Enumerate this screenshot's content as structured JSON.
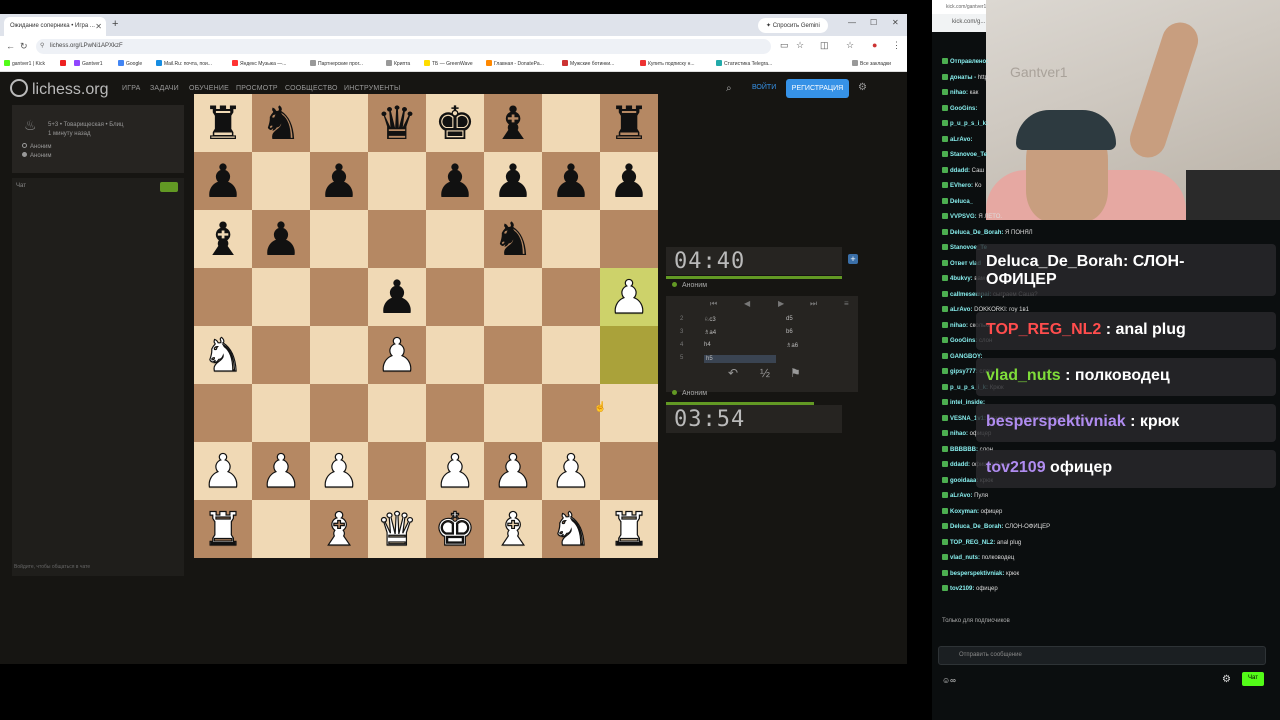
{
  "browser": {
    "tab_title": "Ожидание соперника • Игра ...",
    "new_tab": "+",
    "gemini": "Спросить Gemini",
    "url": "lichess.org/LPwNi1APXkzF",
    "bookmarks": [
      "gantver1 | Kick",
      "Gantver1",
      "Google",
      "Mail.Ru: почта, пои...",
      "Яндекс Музыка —...",
      "Партнерские прог...",
      "Крипта",
      "ТБ — GreenWave",
      "Главная - DonatePa...",
      "Мужские ботинки...",
      "Купить подписку н...",
      "Статистика Telegra...",
      "Все закладки"
    ]
  },
  "lichess": {
    "logo": "lichess.org",
    "nav": [
      "ИГРА",
      "ЗАДАЧИ",
      "ОБУЧЕНИЕ",
      "ПРОСМОТР",
      "СООБЩЕСТВО",
      "ИНСТРУМЕНТЫ"
    ],
    "signin": "ВОЙТИ",
    "register": "РЕГИСТРАЦИЯ",
    "game_mode": "5+3 • Товарищеская • Блиц",
    "game_time": "1 минуту назад",
    "players": [
      "Аноним",
      "Аноним"
    ],
    "chat_label": "Чат",
    "chat_footer": "Войдите, чтобы общаться в чате",
    "top_clock": "04:40",
    "bottom_clock": "03:54",
    "top_player": "Аноним",
    "bottom_player": "Аноним",
    "moves": [
      {
        "n": "2",
        "w": "♘c3",
        "b": "d5"
      },
      {
        "n": "3",
        "w": "♗a4",
        "b": "b6"
      },
      {
        "n": "4",
        "w": "h4",
        "b": "♗a6"
      },
      {
        "n": "5",
        "w": "h5",
        "b": ""
      }
    ],
    "draw": "½",
    "board": [
      [
        "r",
        "n",
        "",
        "q",
        "k",
        "b",
        "",
        "r"
      ],
      [
        "p",
        "",
        "p",
        "",
        "p",
        "p",
        "p",
        "p"
      ],
      [
        "b",
        "p",
        "",
        "",
        "",
        "n",
        "",
        ""
      ],
      [
        "",
        "",
        "",
        "p",
        "",
        "",
        "",
        "P"
      ],
      [
        "N",
        "",
        "",
        "P",
        "",
        "",
        "",
        ""
      ],
      [
        "",
        "",
        "",
        "",
        "",
        "",
        "",
        ""
      ],
      [
        "P",
        "P",
        "P",
        "",
        "P",
        "P",
        "P",
        ""
      ],
      [
        "R",
        "",
        "B",
        "Q",
        "K",
        "B",
        "N",
        "R"
      ]
    ]
  },
  "kick": {
    "tab": "kick.com/gantver1",
    "url": "kick.com/g...",
    "cam_text": "Gantver1",
    "chat": [
      {
        "u": "Отправлено:",
        "t": ""
      },
      {
        "u": "донаты -",
        "t": "http"
      },
      {
        "u": "nihao:",
        "t": "как"
      },
      {
        "u": "GooGins:",
        "t": ""
      },
      {
        "u": "p_u_p_s_i_k:",
        "t": ""
      },
      {
        "u": "aLrAvo:",
        "t": ""
      },
      {
        "u": "Stanovoe_Te",
        "t": ""
      },
      {
        "u": "ddadd:",
        "t": "Саш"
      },
      {
        "u": "EVhero:",
        "t": "Ко"
      },
      {
        "u": "Deluca_",
        "t": ""
      },
      {
        "u": "VVPSVG:",
        "t": "Я ЛЕТО."
      },
      {
        "u": "Deluca_De_Borah:",
        "t": "Я ПОНЯЛ"
      },
      {
        "u": "Stanovoe_Te",
        "t": ""
      },
      {
        "u": "Ответ vlad",
        "t": ""
      },
      {
        "u": "4bukvy:",
        "t": "вам"
      },
      {
        "u": "callmesempai:",
        "t": "сыграем Саша?"
      },
      {
        "u": "aLrAvo:",
        "t": "DOKKORKI: гоу 1в1"
      },
      {
        "u": "nihao:",
        "t": "сколько"
      },
      {
        "u": "GooGins:",
        "t": "слон"
      },
      {
        "u": "GANGBOY:",
        "t": ""
      },
      {
        "u": "gipsy777:",
        "t": "слон"
      },
      {
        "u": "p_u_p_s_i_k:",
        "t": "Крюк"
      },
      {
        "u": "intel_inside:",
        "t": ""
      },
      {
        "u": "VESNA_1v1:",
        "t": "ахахаха очень конечно оригинально"
      },
      {
        "u": "nihao:",
        "t": "офицер"
      },
      {
        "u": "BBBBBB:",
        "t": "слон"
      },
      {
        "u": "ddadd:",
        "t": "офицер Саш"
      },
      {
        "u": "gooidaaa:",
        "t": "крюк"
      },
      {
        "u": "aLrAvo:",
        "t": "Пуля"
      },
      {
        "u": "Koxyman:",
        "t": "офицер"
      },
      {
        "u": "Deluca_De_Borah:",
        "t": "СЛОН-ОФИЦЕР"
      },
      {
        "u": "TOP_REG_NL2:",
        "t": "anal plug"
      },
      {
        "u": "vlad_nuts:",
        "t": "полководец"
      },
      {
        "u": "besperspektivniak:",
        "t": "крюк"
      },
      {
        "u": "tov2109:",
        "t": "офицер"
      }
    ],
    "big": [
      {
        "u": "Deluca_De_Borah",
        "t": ": СЛОН-",
        "t2": "ОФИЦЕР"
      },
      {
        "u": "TOP_REG_NL2",
        "t": ": anal plug"
      },
      {
        "u": "vlad_nuts",
        "t": ": полководец"
      },
      {
        "u": "besperspektivniak",
        "t": ": крюк"
      },
      {
        "u": "tov2109",
        "t": "офицер"
      }
    ],
    "subs_only": "Только для подписчиков",
    "input_placeholder": "Отправить сообщение",
    "chat_button": "Чат"
  }
}
